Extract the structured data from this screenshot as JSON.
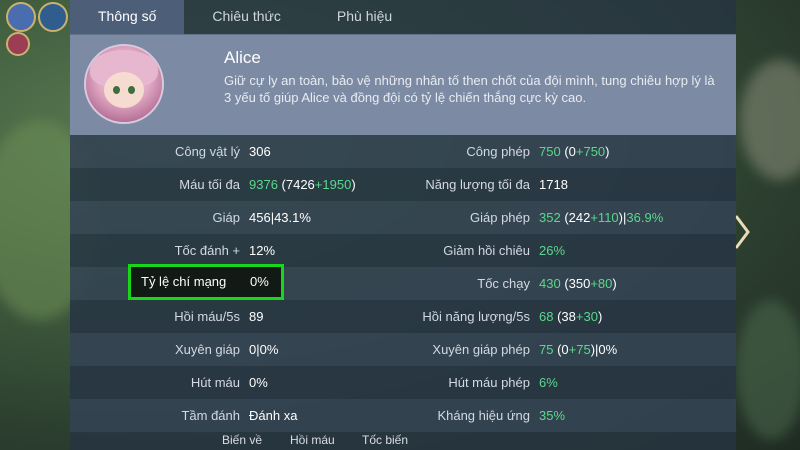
{
  "tabs": [
    {
      "label": "Thông số",
      "active": true
    },
    {
      "label": "Chiêu thức",
      "active": false
    },
    {
      "label": "Phù hiệu",
      "active": false
    }
  ],
  "hero": {
    "name": "Alice",
    "description": "Giữ cự ly an toàn, bảo vệ những nhân tố then chốt của đội mình, tung chiêu hợp lý là 3 yếu tố giúp Alice và đồng đội có tỷ lệ chiến thắng cực kỳ cao."
  },
  "stats": [
    {
      "left_label": "Công vật lý",
      "left_value": "306",
      "right_label": "Công phép",
      "right_value": "750 (0+750)"
    },
    {
      "left_label": "Máu tối đa",
      "left_value": "9376 (7426+1950)",
      "right_label": "Năng lượng tối đa",
      "right_value": "1718"
    },
    {
      "left_label": "Giáp",
      "left_value": "456|43.1%",
      "right_label": "Giáp phép",
      "right_value": "352 (242+110)|36.9%"
    },
    {
      "left_label": "Tốc đánh +",
      "left_value": "12%",
      "right_label": "Giảm hồi chiêu",
      "right_value": "26%"
    },
    {
      "left_label": "Tỷ lệ chí mạng",
      "left_value": "0%",
      "right_label": "Tốc chạy",
      "right_value": "430 (350+80)"
    },
    {
      "left_label": "Hồi máu/5s",
      "left_value": "89",
      "right_label": "Hồi năng lượng/5s",
      "right_value": "68 (38+30)"
    },
    {
      "left_label": "Xuyên giáp",
      "left_value": "0|0%",
      "right_label": "Xuyên giáp phép",
      "right_value": "75 (0+75)|0%"
    },
    {
      "left_label": "Hút máu",
      "left_value": "0%",
      "right_label": "Hút máu phép",
      "right_value": "6%"
    },
    {
      "left_label": "Tầm đánh",
      "left_value": "Đánh xa",
      "right_label": "Kháng hiệu ứng",
      "right_value": "35%"
    }
  ],
  "value_parts": {
    "cong_phep": {
      "a": "750",
      "b": " (0",
      "c": "+750",
      "d": ")"
    },
    "mau": {
      "a": "9376",
      "b": " (7426",
      "c": "+1950",
      "d": ")"
    },
    "giap_phep": {
      "a": "352",
      "b": " (242",
      "c": "+110",
      "d": ")|",
      "e": "36.9%"
    },
    "toc_chay": {
      "a": "430",
      "b": " (350",
      "c": "+80",
      "d": ")"
    },
    "hoi_nl": {
      "a": "68",
      "b": " (38",
      "c": "+30",
      "d": ")"
    },
    "xuyen_giap_phep": {
      "a": "75",
      "b": " (0",
      "c": "+75",
      "d": ")|0%"
    }
  },
  "highlight": {
    "label": "Tỷ lệ chí mạng",
    "value": "0%",
    "color": "#18d718"
  },
  "bottom_hud": {
    "a": "Biến về",
    "b": "Hồi máu",
    "c": "Tốc biến"
  },
  "colors": {
    "bonus_green": "#59d98c",
    "tab_active": "#4d5f78",
    "header_bg": "#7c8aa3"
  }
}
